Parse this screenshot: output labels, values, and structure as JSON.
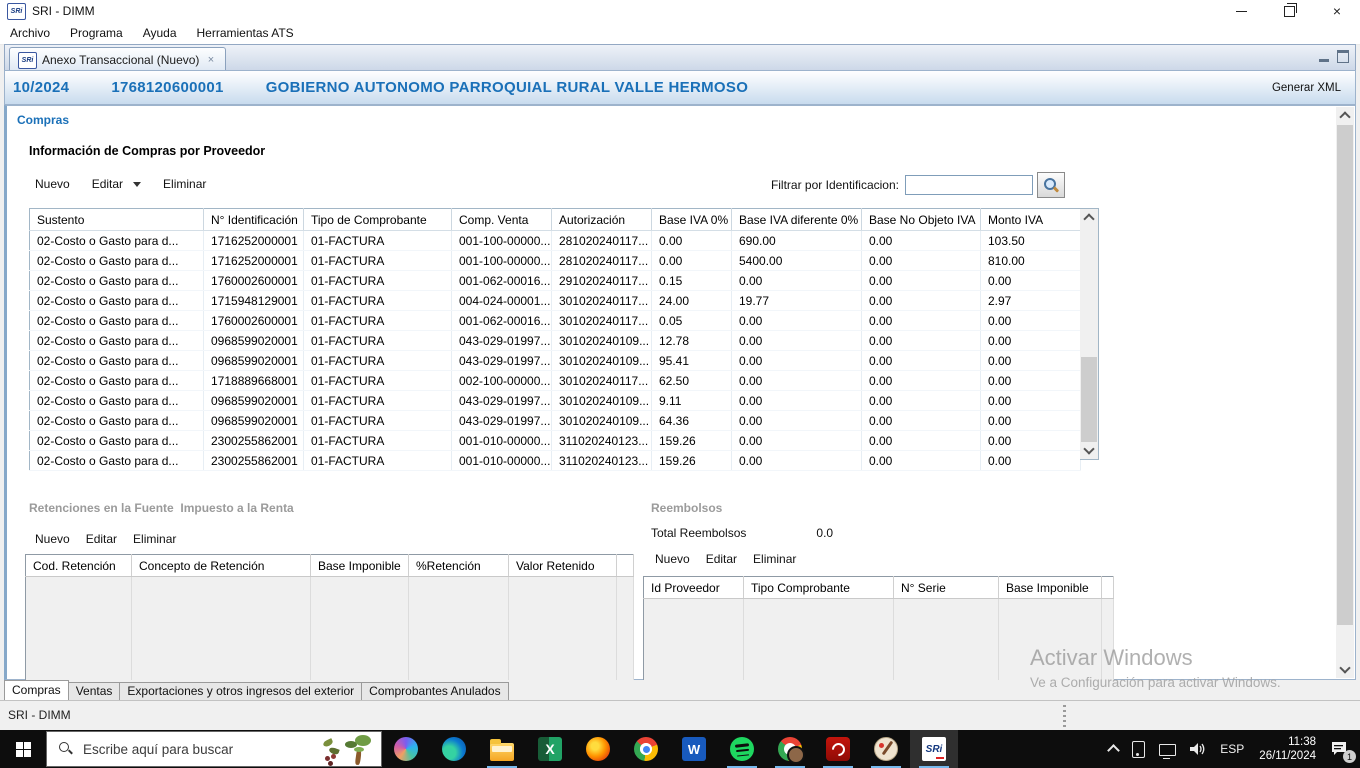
{
  "window": {
    "title": "SRI - DIMM",
    "menu": [
      "Archivo",
      "Programa",
      "Ayuda",
      "Herramientas ATS"
    ]
  },
  "tab": {
    "label": "Anexo Transaccional (Nuevo)",
    "close_glyph": "×"
  },
  "header": {
    "period": "10/2024",
    "ruc": "1768120600001",
    "name": "GOBIERNO AUTONOMO PARROQUIAL RURAL VALLE HERMOSO",
    "generate_xml": "Generar XML"
  },
  "compras": {
    "section_label": "Compras",
    "title": "Información de Compras por Proveedor",
    "toolbar": {
      "nuevo": "Nuevo",
      "editar": "Editar",
      "eliminar": "Eliminar"
    },
    "filter_label": "Filtrar por Identificacion:",
    "filter_value": "",
    "table": {
      "columns": [
        "Sustento",
        "N° Identificación",
        "Tipo de Comprobante",
        "Comp. Venta",
        "Autorización",
        "Base IVA 0%",
        "Base IVA diferente 0%",
        "Base No Objeto IVA",
        "Monto IVA"
      ],
      "rows": [
        [
          "02-Costo o Gasto para d...",
          "1716252000001",
          "01-FACTURA",
          "001-100-00000...",
          "281020240117...",
          "0.00",
          "690.00",
          "0.00",
          "103.50"
        ],
        [
          "02-Costo o Gasto para d...",
          "1716252000001",
          "01-FACTURA",
          "001-100-00000...",
          "281020240117...",
          "0.00",
          "5400.00",
          "0.00",
          "810.00"
        ],
        [
          "02-Costo o Gasto para d...",
          "1760002600001",
          "01-FACTURA",
          "001-062-00016...",
          "291020240117...",
          "0.15",
          "0.00",
          "0.00",
          "0.00"
        ],
        [
          "02-Costo o Gasto para d...",
          "1715948129001",
          "01-FACTURA",
          "004-024-00001...",
          "301020240117...",
          "24.00",
          "19.77",
          "0.00",
          "2.97"
        ],
        [
          "02-Costo o Gasto para d...",
          "1760002600001",
          "01-FACTURA",
          "001-062-00016...",
          "301020240117...",
          "0.05",
          "0.00",
          "0.00",
          "0.00"
        ],
        [
          "02-Costo o Gasto para d...",
          "0968599020001",
          "01-FACTURA",
          "043-029-01997...",
          "301020240109...",
          "12.78",
          "0.00",
          "0.00",
          "0.00"
        ],
        [
          "02-Costo o Gasto para d...",
          "0968599020001",
          "01-FACTURA",
          "043-029-01997...",
          "301020240109...",
          "95.41",
          "0.00",
          "0.00",
          "0.00"
        ],
        [
          "02-Costo o Gasto para d...",
          "1718889668001",
          "01-FACTURA",
          "002-100-00000...",
          "301020240117...",
          "62.50",
          "0.00",
          "0.00",
          "0.00"
        ],
        [
          "02-Costo o Gasto para d...",
          "0968599020001",
          "01-FACTURA",
          "043-029-01997...",
          "301020240109...",
          "9.11",
          "0.00",
          "0.00",
          "0.00"
        ],
        [
          "02-Costo o Gasto para d...",
          "0968599020001",
          "01-FACTURA",
          "043-029-01997...",
          "301020240109...",
          "64.36",
          "0.00",
          "0.00",
          "0.00"
        ],
        [
          "02-Costo o Gasto para d...",
          "2300255862001",
          "01-FACTURA",
          "001-010-00000...",
          "311020240123...",
          "159.26",
          "0.00",
          "0.00",
          "0.00"
        ],
        [
          "02-Costo o Gasto para d...",
          "2300255862001",
          "01-FACTURA",
          "001-010-00000...",
          "311020240123...",
          "159.26",
          "0.00",
          "0.00",
          "0.00"
        ]
      ]
    }
  },
  "retenciones": {
    "title": "Retenciones en la Fuente  Impuesto a la Renta",
    "toolbar": {
      "nuevo": "Nuevo",
      "editar": "Editar",
      "eliminar": "Eliminar"
    },
    "columns": [
      "Cod. Retención",
      "Concepto de Retención",
      "Base Imponible",
      "%Retención",
      "Valor Retenido"
    ]
  },
  "reembolsos": {
    "title": "Reembolsos",
    "total_label": "Total Reembolsos",
    "total_value": "0.0",
    "toolbar": {
      "nuevo": "Nuevo",
      "editar": "Editar",
      "eliminar": "Eliminar"
    },
    "columns": [
      "Id Proveedor",
      "Tipo Comprobante",
      "N° Serie",
      "Base Imponible"
    ]
  },
  "bottom_tabs": [
    "Compras",
    "Ventas",
    "Exportaciones y otros ingresos del exterior",
    "Comprobantes Anulados"
  ],
  "status_bar": {
    "text": "SRI - DIMM"
  },
  "watermark": {
    "line1": "Activar Windows",
    "line2": "Ve a Configuración para activar Windows."
  },
  "taskbar": {
    "search_placeholder": "Escribe aquí para buscar",
    "icons": [
      {
        "name": "copilot",
        "running": false
      },
      {
        "name": "edge",
        "running": false
      },
      {
        "name": "file-explorer",
        "running": true
      },
      {
        "name": "excel",
        "running": false
      },
      {
        "name": "firefox",
        "running": false
      },
      {
        "name": "chrome",
        "running": false
      },
      {
        "name": "word",
        "running": false
      },
      {
        "name": "spotify",
        "running": true
      },
      {
        "name": "chrome-profile",
        "running": true
      },
      {
        "name": "acrobat",
        "running": true
      },
      {
        "name": "paint",
        "running": true
      },
      {
        "name": "sri-dimm",
        "running": true,
        "active": true
      }
    ],
    "tray": {
      "language": "ESP",
      "time": "11:38",
      "date": "26/11/2024",
      "notification_count": "1"
    }
  }
}
